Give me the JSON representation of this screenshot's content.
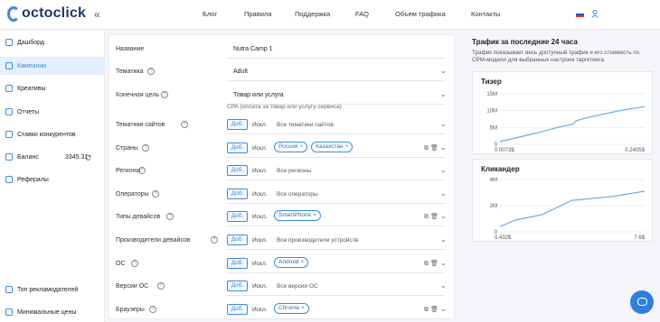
{
  "brand": {
    "logo_text": "octoclick",
    "collapse_icon": "«"
  },
  "nav": [
    "Блог",
    "Правила",
    "Поддержка",
    "FAQ",
    "Объем трафика",
    "Контакты"
  ],
  "header": {
    "flag_colors": [
      "#ffffff",
      "#2c4fbf",
      "#d33a3a"
    ],
    "user_icon": "user-icon"
  },
  "sidebar": {
    "items": [
      {
        "label": "Дашборд"
      },
      {
        "label": "Кампании"
      },
      {
        "label": "Креативы"
      },
      {
        "label": "Отчеты"
      },
      {
        "label": "Ставки конкурентов"
      },
      {
        "label": "Баланс",
        "value": "3345.31"
      },
      {
        "label": "Рефералы"
      }
    ],
    "bottom": [
      {
        "label": "Топ рекламодателей"
      },
      {
        "label": "Минимальные цены"
      }
    ]
  },
  "form": {
    "add_label": "Доб.",
    "exclude_label": "Искл.",
    "name": {
      "label": "Название",
      "value": "Nutra Camp 1"
    },
    "topic": {
      "label": "Тематика",
      "value": "Adult"
    },
    "goal": {
      "label": "Конечная цель",
      "value": "Товар или услуга"
    },
    "hint": "CPA (оплата за товар или услугу сервиса)",
    "rows": [
      {
        "label": "Тематики сайтов",
        "placeholder": "Все тематики сайтов",
        "chips": []
      },
      {
        "label": "Страны",
        "placeholder": "",
        "chips": [
          "Россия",
          "Казахстан"
        ]
      },
      {
        "label": "Регионы",
        "placeholder": "Все регионы",
        "chips": []
      },
      {
        "label": "Операторы",
        "placeholder": "Все операторы",
        "chips": []
      },
      {
        "label": "Типы девайсов",
        "placeholder": "",
        "chips": [
          "SmartPhone"
        ]
      },
      {
        "label": "Производители девайсов",
        "placeholder": "Все производители устройств",
        "chips": []
      },
      {
        "label": "ОС",
        "placeholder": "",
        "chips": [
          "Android"
        ]
      },
      {
        "label": "Версии ОС",
        "placeholder": "Все версии ОС",
        "chips": []
      },
      {
        "label": "Браузеры",
        "placeholder": "",
        "chips": [
          "Chrome"
        ]
      }
    ]
  },
  "traffic": {
    "title": "Трафик за последние 24 часа",
    "description": "Трафик показывает весь доступный трафик и его стоимость по CPM-модели для выбранных настроек таргетинга."
  },
  "chart_data": [
    {
      "type": "line",
      "title": "Тизер",
      "y_ticks": [
        "15M",
        "10M",
        "5M",
        "0"
      ],
      "ylim": [
        0,
        15000000
      ],
      "x_labels": [
        "0.0073$",
        "0.2405$"
      ],
      "x": [
        0.0073,
        0.035,
        0.07,
        0.1,
        0.125,
        0.13,
        0.15,
        0.2,
        0.2405
      ],
      "y": [
        800000,
        2000000,
        3500000,
        5000000,
        6000000,
        7000000,
        8000000,
        10000000,
        11200000
      ]
    },
    {
      "type": "line",
      "title": "Кликандер",
      "y_ticks": [
        "4M",
        "2M",
        "0"
      ],
      "ylim": [
        0,
        4000000
      ],
      "x_labels": [
        "0.432$",
        "7.6$"
      ],
      "x": [
        0.432,
        1.2,
        2.5,
        4.0,
        6.0,
        7.6
      ],
      "y": [
        400000,
        900000,
        1300000,
        2400000,
        2700000,
        3100000
      ]
    }
  ],
  "chat": {
    "icon": "chat-icon"
  }
}
